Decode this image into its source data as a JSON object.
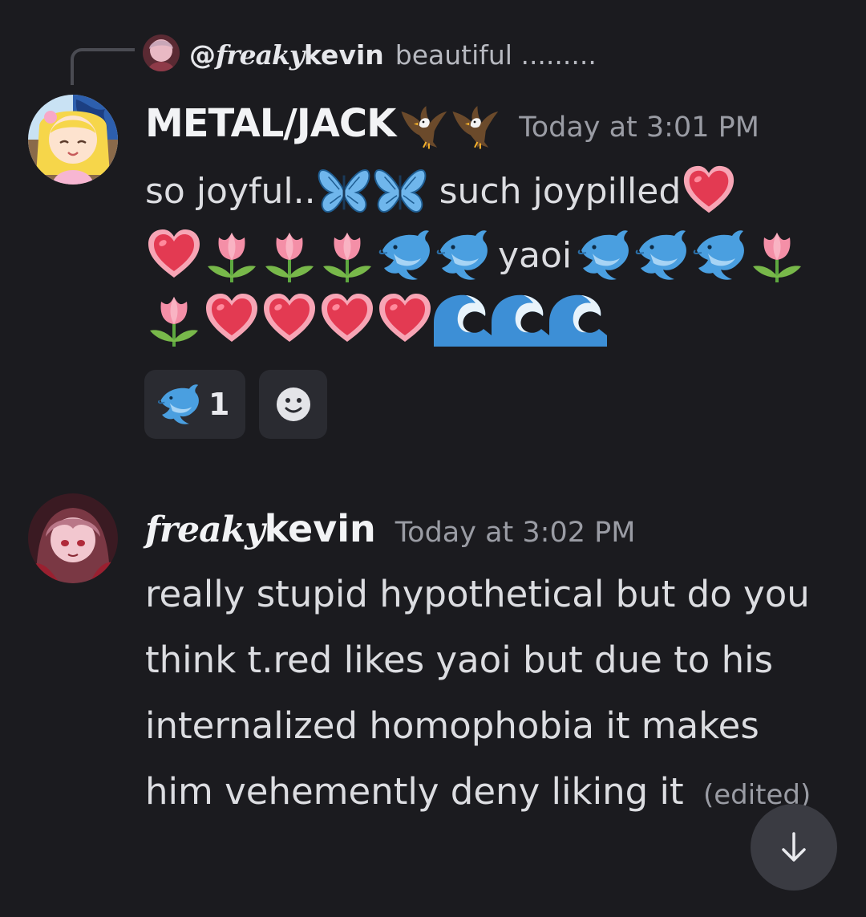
{
  "reply": {
    "prefix": "@",
    "handle_script": "freaky",
    "handle_plain": "kevin",
    "preview": "beautiful ........."
  },
  "message1": {
    "author": "METAL/JACK",
    "badge_icons": [
      "eagle-icon",
      "eagle-icon"
    ],
    "timestamp": "Today at 3:01 PM",
    "line1_text_a": "so joyful..",
    "line1_text_b": "such joypilled",
    "line2_word": "yaoi",
    "line1_emojis": [
      "butterfly",
      "butterfly",
      "heart"
    ],
    "line2_emojis": [
      "heart",
      "tulip",
      "tulip",
      "tulip",
      "dolphin",
      "dolphin",
      "dolphin",
      "dolphin",
      "dolphin",
      "tulip"
    ],
    "line3_emojis": [
      "tulip",
      "heart",
      "heart",
      "heart",
      "heart",
      "wave",
      "wave",
      "wave"
    ],
    "reactions": [
      {
        "emoji": "dolphin",
        "count": "1"
      }
    ],
    "add_reaction_icon": "smiley-icon"
  },
  "message2": {
    "author_script": "freaky",
    "author_plain": "kevin",
    "timestamp": "Today at 3:02 PM",
    "text": "really stupid hypothetical but do you think t.red likes yaoi but due to his internalized homophobia it makes him vehemently deny liking it",
    "edited": "(edited)"
  },
  "scroll_button": {
    "icon": "arrow-down-icon"
  },
  "colors": {
    "background": "#1b1b1f",
    "text": "#dcdde1",
    "muted": "#9a9ca4",
    "reaction_bg": "#2a2b31",
    "heart": "#e8445a",
    "tulip": "#f48fa7",
    "dolphin": "#4a9fe0",
    "wave": "#3d8fd6"
  }
}
